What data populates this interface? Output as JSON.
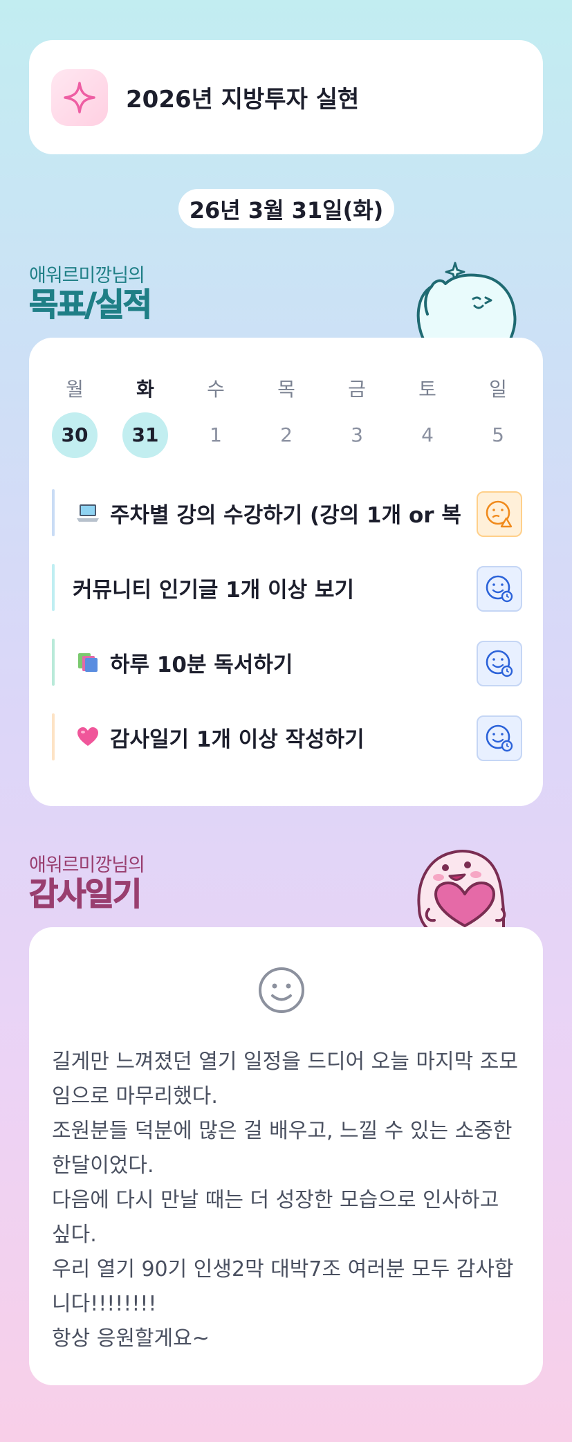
{
  "goal": {
    "title": "2026년 지방투자 실현",
    "icon": "sparkle-icon"
  },
  "date": "26년 3월 31일(화)",
  "goal_section": {
    "subtitle": "애워르미깡님의",
    "title": "목표/실적"
  },
  "week": {
    "days": [
      "월",
      "화",
      "수",
      "목",
      "금",
      "토",
      "일"
    ],
    "dates": [
      "30",
      "31",
      "1",
      "2",
      "3",
      "4",
      "5"
    ],
    "active_day": "화"
  },
  "tasks": [
    {
      "label": "주차별 강의 수강하기 (강의 1개 or 복",
      "emoji": "laptop-icon",
      "bar_color": "#c9dcf5",
      "status": "warning",
      "status_icon": "sad-face-warning-icon"
    },
    {
      "label": "커뮤니티 인기글 1개 이상 보기",
      "emoji": "",
      "bar_color": "#bfeef2",
      "status": "ok",
      "status_icon": "smile-face-clock-icon"
    },
    {
      "label": "하루 10분 독서하기",
      "emoji": "books-icon",
      "bar_color": "#b9ead9",
      "status": "ok",
      "status_icon": "smile-face-clock-icon"
    },
    {
      "label": "감사일기 1개 이상 작성하기",
      "emoji": "heart-icon",
      "bar_color": "#fde3c5",
      "status": "ok",
      "status_icon": "smile-face-clock-icon"
    }
  ],
  "diary_section": {
    "subtitle": "애워르미깡님의",
    "title": "감사일기"
  },
  "diary": {
    "mood_icon": "smile-face-icon",
    "text": "길게만 느껴졌던 열기 일정을 드디어 오늘 마지막 조모임으로 마무리했다.\n조원분들 덕분에 많은 걸 배우고, 느낄 수 있는 소중한 한달이었다.\n다음에 다시 만날 때는 더 성장한 모습으로 인사하고 싶다.\n우리 열기 90기 인생2막 대박7조 여러분 모두 감사합니다!!!!!!!!\n항상 응원할게요~"
  }
}
